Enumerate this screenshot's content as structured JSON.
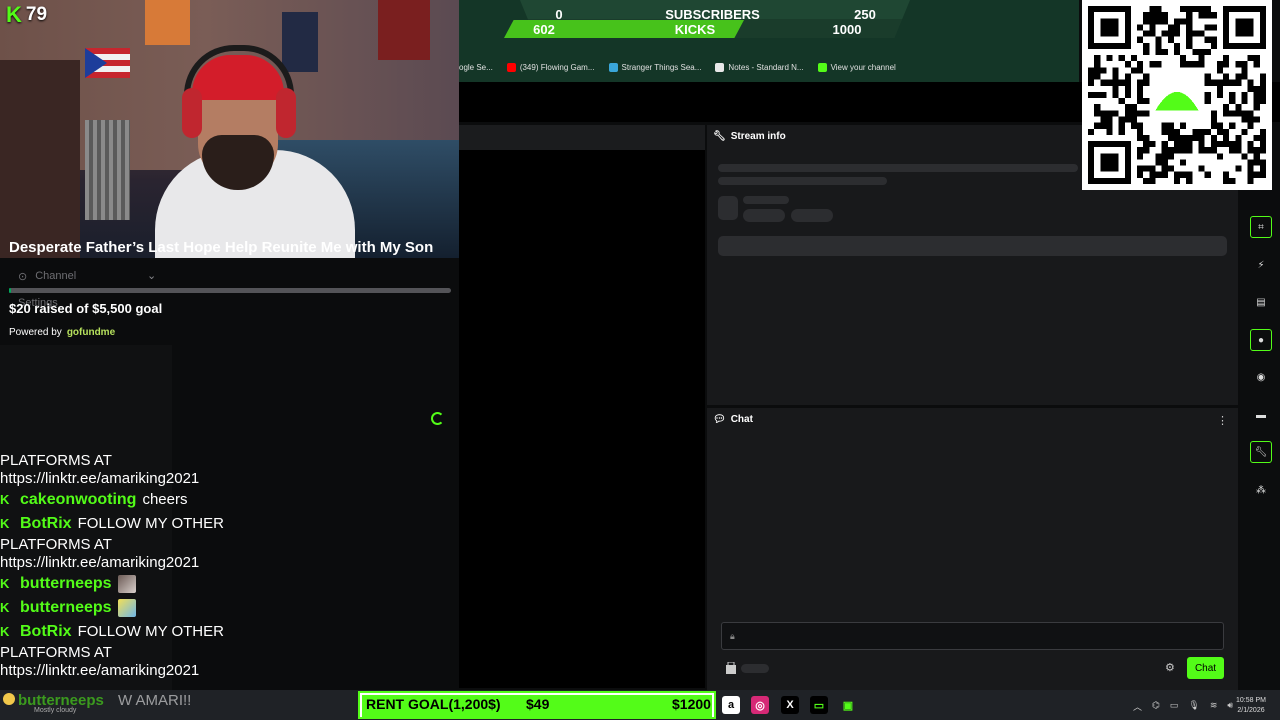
{
  "kick_badge": {
    "count": "79"
  },
  "gofundme": {
    "title": "Desperate Father’s Last Hope Help Reunite Me with My Son",
    "raised_text": "$20 raised of $5,500 goal",
    "progress_fraction": 0.0036,
    "powered_by": "Powered by",
    "brand": "gofundme",
    "ghost_channel": "Channel",
    "ghost_settings": "Settings"
  },
  "chat_overlay": [
    {
      "type": "cont",
      "text": "PLATFORMS AT"
    },
    {
      "type": "cont",
      "text": "https://linktr.ee/amariking2021"
    },
    {
      "type": "msg",
      "user": "cakeonwooting",
      "text": "cheers"
    },
    {
      "type": "msg",
      "user": "BotRix",
      "text": "FOLLOW MY OTHER"
    },
    {
      "type": "cont",
      "text": "PLATFORMS AT"
    },
    {
      "type": "cont",
      "text": "https://linktr.ee/amariking2021"
    },
    {
      "type": "msg",
      "user": "butterneeps",
      "emote": "em1"
    },
    {
      "type": "msg",
      "user": "butterneeps",
      "emote": "em2"
    },
    {
      "type": "msg",
      "user": "BotRix",
      "text": "FOLLOW MY OTHER"
    },
    {
      "type": "cont",
      "text": "PLATFORMS AT"
    },
    {
      "type": "cont",
      "text": "https://linktr.ee/amariking2021"
    }
  ],
  "scoreboard": {
    "left_top": "0",
    "left_bottom": "602",
    "mid_top": "SUBSCRIBERS",
    "mid_bottom": "KICKS",
    "right_top": "250",
    "right_bottom": "1000"
  },
  "bookmarks": [
    {
      "label": "ogle Se...",
      "color": "#555555"
    },
    {
      "label": "(349) Flowing Gam...",
      "color": "#ff0000"
    },
    {
      "label": "Stranger Things Sea...",
      "color": "#3aa6d9"
    },
    {
      "label": "Notes - Standard N...",
      "color": "#e8e8e8"
    },
    {
      "label": "View your channel",
      "color": "#53fc18"
    }
  ],
  "stream_panel": {
    "title": "Stream info"
  },
  "chat_panel": {
    "title": "Chat",
    "send_label": "Chat"
  },
  "bottom_overlay": {
    "user": "butterneeps",
    "message": "W AMARI!!",
    "sub": "Mostly cloudy"
  },
  "rent_goal": {
    "title": "RENT GOAL(1,200$)",
    "current": "$49",
    "target": "$1200",
    "fraction": 0.04
  },
  "taskbar_apps": [
    {
      "name": "amazon-app-icon",
      "glyph": "a",
      "bg": "#ffffff",
      "fg": "#000000"
    },
    {
      "name": "instagram-app-icon",
      "glyph": "◎",
      "bg": "#d62976",
      "fg": "#ffffff"
    },
    {
      "name": "x-app-icon",
      "glyph": "X",
      "bg": "#000000",
      "fg": "#ffffff"
    },
    {
      "name": "terminal-app-icon",
      "glyph": "▭",
      "bg": "#000000",
      "fg": "#53fc18"
    },
    {
      "name": "kick-studio-app-icon",
      "glyph": "▣",
      "bg": "#1f2226",
      "fg": "#53fc18"
    }
  ],
  "clock": {
    "time": "10:58 PM",
    "date": "2/1/2026"
  },
  "colors": {
    "accent": "#53fc18",
    "gofundme_green": "#02a95c"
  }
}
